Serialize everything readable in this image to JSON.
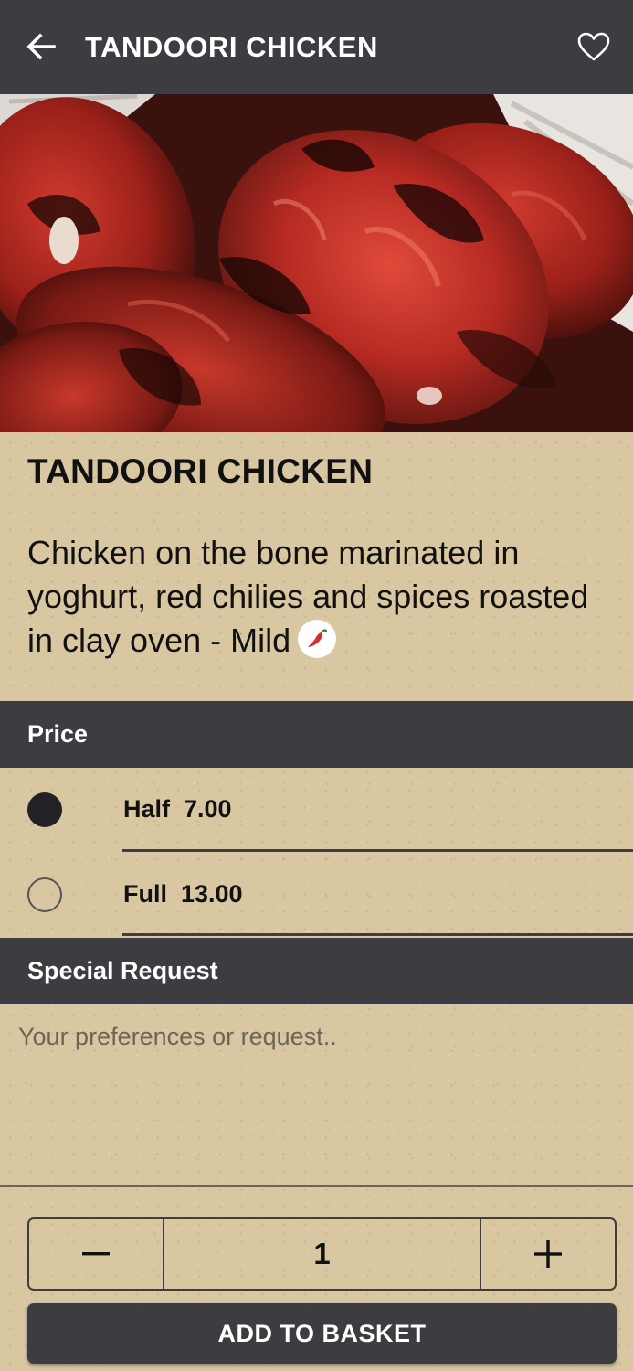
{
  "header": {
    "title": "TANDOORI CHICKEN",
    "back_icon": "arrow-left-icon",
    "favorite_icon": "heart-outline-icon"
  },
  "item": {
    "title": "TANDOORI CHICKEN",
    "description": "Chicken on the bone marinated in yoghurt, red chilies and spices roasted in clay oven - Mild",
    "spice_icon": "chili-pepper-icon"
  },
  "price_section": {
    "label": "Price",
    "options": [
      {
        "label": "Half  7.00",
        "selected": true
      },
      {
        "label": "Full  13.00",
        "selected": false
      }
    ]
  },
  "special_request": {
    "label": "Special Request",
    "placeholder": "Your preferences or request.."
  },
  "quantity": {
    "value": "1",
    "minus_symbol": "−",
    "plus_symbol": "+"
  },
  "actions": {
    "add_to_basket": "ADD TO BASKET"
  },
  "colors": {
    "bar": "#3d3c40",
    "paper": "#d9c7a2",
    "text": "#111111",
    "chili": "#d32f2f"
  }
}
